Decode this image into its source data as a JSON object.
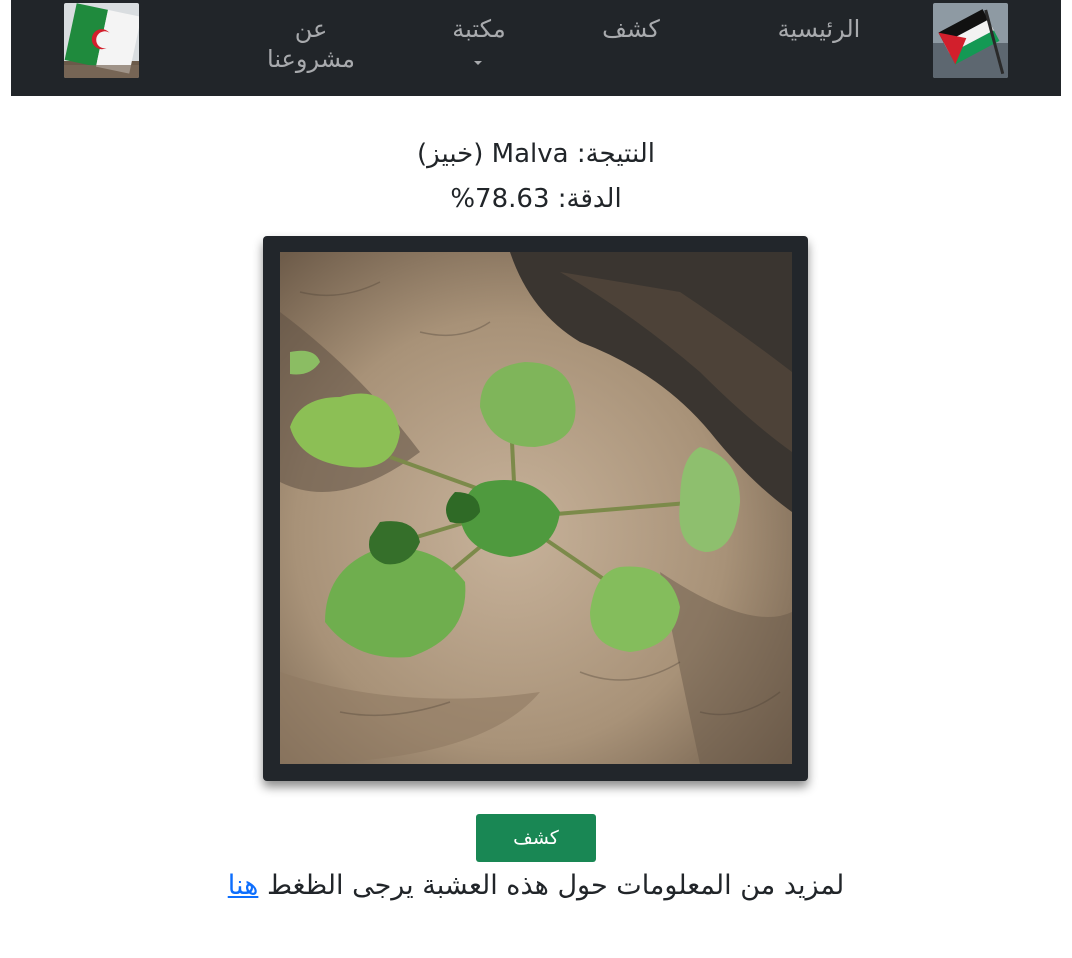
{
  "navbar": {
    "home_label": "الرئيسية",
    "detect_label": "كشف",
    "library_label": "مكتبة",
    "about_label": "عن مشروعنا",
    "left_flag": "algeria-flag",
    "right_flag": "palestine-flag"
  },
  "result": {
    "label_line": "النتيجة: Malva (خبيز)",
    "accuracy_line": "الدقة: 78.63%"
  },
  "photo": {
    "subject": "malva-plant-photo"
  },
  "actions": {
    "detect_button_label": "كشف"
  },
  "more_info": {
    "text": "لمزيد من المعلومات حول هذه العشبة يرجى الظغط",
    "link_label": "هنا"
  },
  "colors": {
    "navbar_bg": "#212529",
    "button_bg": "#198754",
    "link": "#0d6efd"
  }
}
